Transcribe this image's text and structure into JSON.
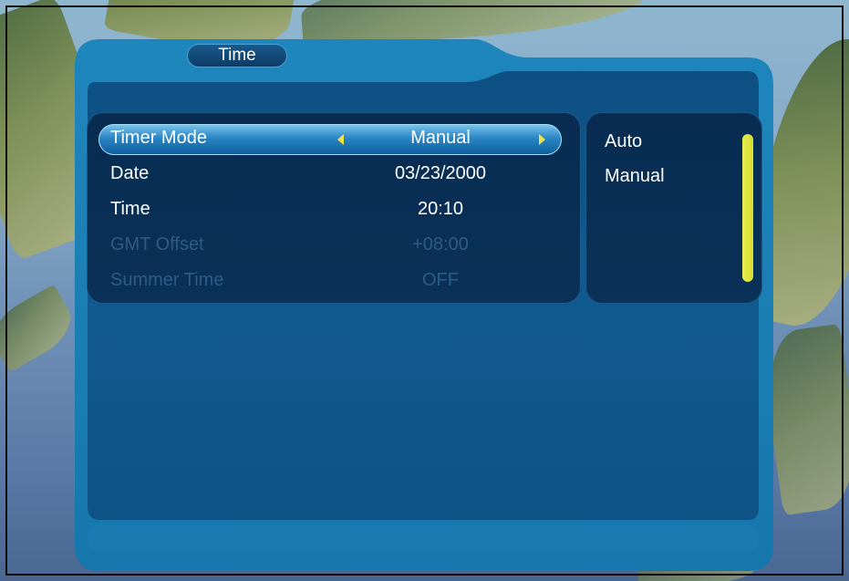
{
  "window": {
    "tab_title": "Time"
  },
  "menu": {
    "rows": [
      {
        "label": "Timer Mode",
        "value": "Manual",
        "selected": true,
        "enabled": true
      },
      {
        "label": "Date",
        "value": "03/23/2000",
        "selected": false,
        "enabled": true
      },
      {
        "label": "Time",
        "value": "20:10",
        "selected": false,
        "enabled": true
      },
      {
        "label": "GMT Offset",
        "value": "+08:00",
        "selected": false,
        "enabled": false
      },
      {
        "label": "Summer Time",
        "value": "OFF",
        "selected": false,
        "enabled": false
      }
    ]
  },
  "options": {
    "items": [
      "Auto",
      "Manual"
    ],
    "scroll_fraction": 1.0
  },
  "colors": {
    "accent_yellow": "#f1e44a",
    "highlight_blue": "#2b86c4",
    "panel_blue": "#0a3158",
    "disabled_text": "#2c5c86"
  },
  "icons": {
    "left_arrow": "triangle-left-icon",
    "right_arrow": "triangle-right-icon"
  }
}
